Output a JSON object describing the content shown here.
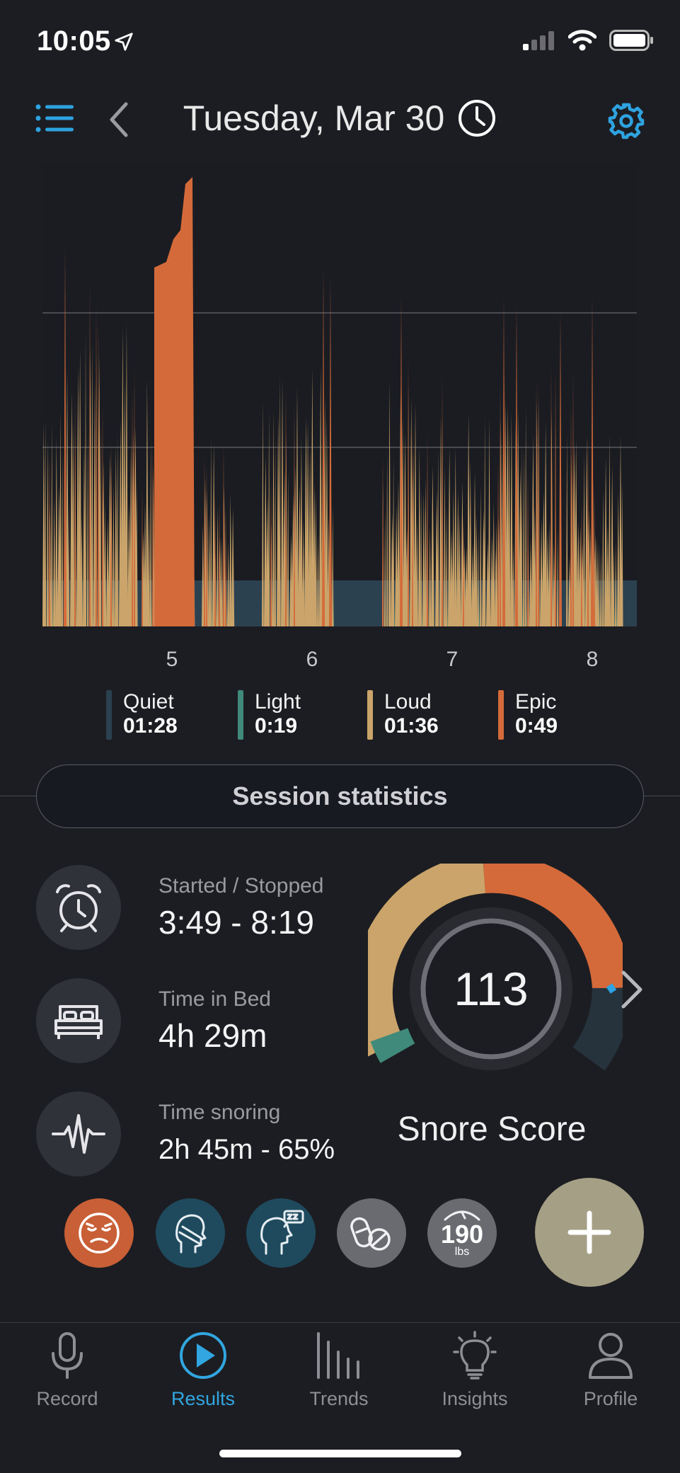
{
  "status_bar": {
    "time": "10:05"
  },
  "header": {
    "title": "Tuesday, Mar 30"
  },
  "chart_data": {
    "type": "area",
    "x_ticks": [
      "5",
      "6",
      "7",
      "8"
    ],
    "series": [
      {
        "name": "Quiet",
        "color": "#2b4150"
      },
      {
        "name": "Light",
        "color": "#3f8a7a"
      },
      {
        "name": "Loud",
        "color": "#caa46a"
      },
      {
        "name": "Epic",
        "color": "#d46a3a"
      }
    ]
  },
  "legend": [
    {
      "name": "Quiet",
      "value": "01:28",
      "color": "#2b4150"
    },
    {
      "name": "Light",
      "value": "0:19",
      "color": "#3f8a7a"
    },
    {
      "name": "Loud",
      "value": "01:36",
      "color": "#caa46a"
    },
    {
      "name": "Epic",
      "value": "0:49",
      "color": "#d46a3a"
    }
  ],
  "session": {
    "button_label": "Session statistics",
    "started_label": "Started / Stopped",
    "started_value": "3:49 - 8:19",
    "bed_label": "Time in Bed",
    "bed_value": "4h 29m",
    "snoring_label": "Time snoring",
    "snoring_value": "2h 45m - 65%"
  },
  "snore_score": {
    "value": "113",
    "label": "Snore Score"
  },
  "factors": {
    "weight_value": "190",
    "weight_unit": "lbs"
  },
  "tabs": [
    {
      "label": "Record",
      "icon": "microphone-icon"
    },
    {
      "label": "Results",
      "icon": "play-circle-icon"
    },
    {
      "label": "Trends",
      "icon": "bars-icon"
    },
    {
      "label": "Insights",
      "icon": "lightbulb-icon"
    },
    {
      "label": "Profile",
      "icon": "person-icon"
    }
  ]
}
